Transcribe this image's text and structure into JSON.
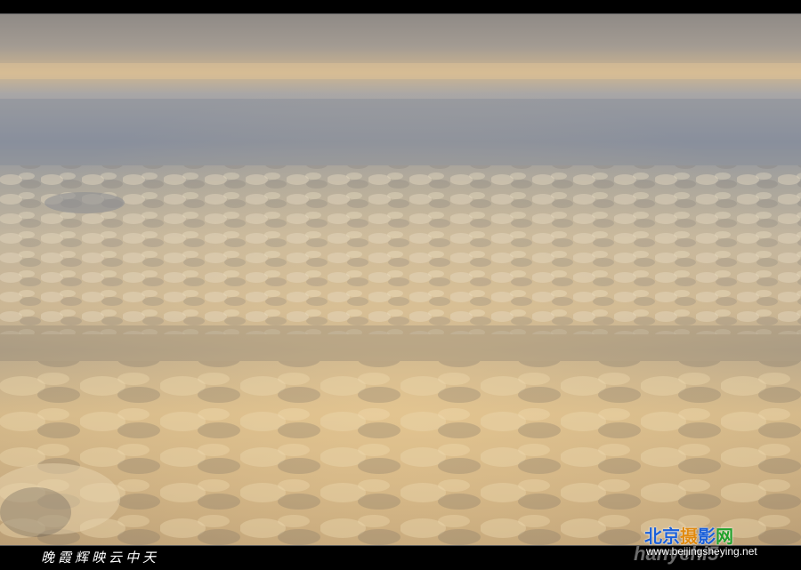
{
  "caption": "晚霞辉映云中天",
  "author": "hanyehi5",
  "logo": {
    "chars": [
      "北",
      "京",
      "摄",
      "影",
      "网"
    ],
    "colors": [
      "#1a5fd8",
      "#1a5fd8",
      "#e08a10",
      "#1a5fd8",
      "#22a02a"
    ]
  },
  "site_url": "www.beijingsheying.net"
}
